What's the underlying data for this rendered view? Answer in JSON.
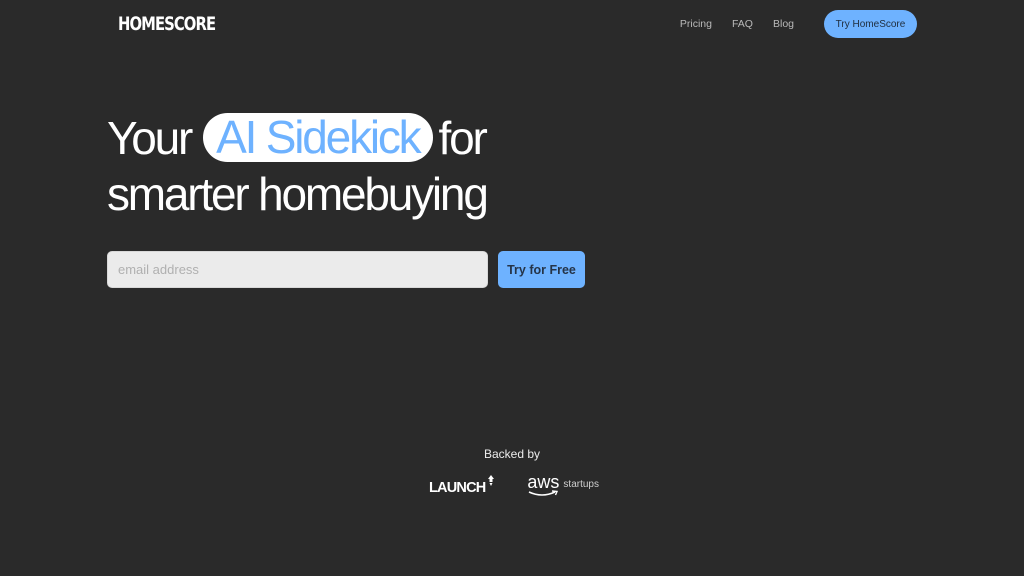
{
  "header": {
    "logo": "HOMESCORE",
    "nav": [
      {
        "label": "Pricing"
      },
      {
        "label": "FAQ"
      },
      {
        "label": "Blog"
      }
    ],
    "cta_label": "Try HomeScore"
  },
  "hero": {
    "line1_before": "Your",
    "highlight": "AI Sidekick",
    "line1_after": "for",
    "line2": "smarter homebuying"
  },
  "signup": {
    "email_placeholder": "email address",
    "email_value": "",
    "button_label": "Try for Free"
  },
  "backers": {
    "heading": "Backed by",
    "items": [
      {
        "name": "LAUNCH",
        "icon": "rocket-icon"
      },
      {
        "name": "aws",
        "suffix": "startups",
        "icon": "aws-smile-icon"
      }
    ]
  },
  "colors": {
    "background": "#2a2a2a",
    "accent": "#6eb2ff",
    "input_bg": "#ebebeb"
  }
}
